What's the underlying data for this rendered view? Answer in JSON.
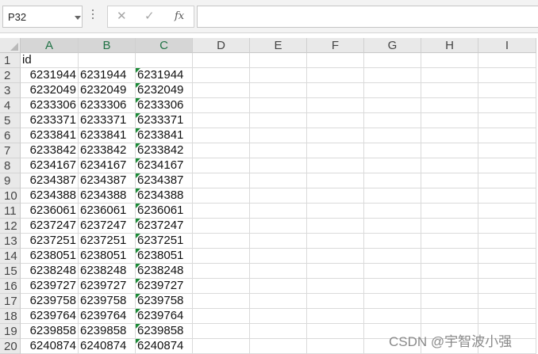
{
  "formula_bar": {
    "name_box": "P32",
    "cancel_icon": "✕",
    "enter_icon": "✓",
    "fx_icon": "fx",
    "formula": ""
  },
  "columns": [
    "A",
    "B",
    "C",
    "D",
    "E",
    "F",
    "G",
    "H",
    "I"
  ],
  "rows": [
    {
      "n": "1",
      "a": "",
      "b": "",
      "c": "",
      "title": "id"
    },
    {
      "n": "2",
      "a": "6231944",
      "b": "6231944",
      "c": "6231944"
    },
    {
      "n": "3",
      "a": "6232049",
      "b": "6232049",
      "c": "6232049"
    },
    {
      "n": "4",
      "a": "6233306",
      "b": "6233306",
      "c": "6233306"
    },
    {
      "n": "5",
      "a": "6233371",
      "b": "6233371",
      "c": "6233371"
    },
    {
      "n": "6",
      "a": "6233841",
      "b": "6233841",
      "c": "6233841"
    },
    {
      "n": "7",
      "a": "6233842",
      "b": "6233842",
      "c": "6233842"
    },
    {
      "n": "8",
      "a": "6234167",
      "b": "6234167",
      "c": "6234167"
    },
    {
      "n": "9",
      "a": "6234387",
      "b": "6234387",
      "c": "6234387"
    },
    {
      "n": "10",
      "a": "6234388",
      "b": "6234388",
      "c": "6234388"
    },
    {
      "n": "11",
      "a": "6236061",
      "b": "6236061",
      "c": "6236061"
    },
    {
      "n": "12",
      "a": "6237247",
      "b": "6237247",
      "c": "6237247"
    },
    {
      "n": "13",
      "a": "6237251",
      "b": "6237251",
      "c": "6237251"
    },
    {
      "n": "14",
      "a": "6238051",
      "b": "6238051",
      "c": "6238051"
    },
    {
      "n": "15",
      "a": "6238248",
      "b": "6238248",
      "c": "6238248"
    },
    {
      "n": "16",
      "a": "6239727",
      "b": "6239727",
      "c": "6239727"
    },
    {
      "n": "17",
      "a": "6239758",
      "b": "6239758",
      "c": "6239758"
    },
    {
      "n": "18",
      "a": "6239764",
      "b": "6239764",
      "c": "6239764"
    },
    {
      "n": "19",
      "a": "6239858",
      "b": "6239858",
      "c": "6239858"
    },
    {
      "n": "20",
      "a": "6240874",
      "b": "6240874",
      "c": "6240874"
    }
  ],
  "watermark": "CSDN @宇智波小强",
  "colors": {
    "text_flag": "#1a8a36",
    "header_bg": "#e9e9e9",
    "gridline": "#dadada"
  }
}
